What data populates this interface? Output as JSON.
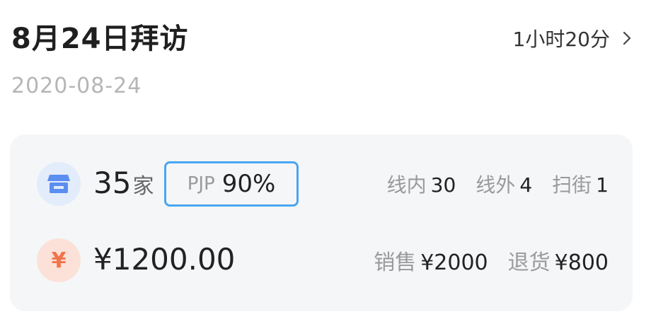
{
  "header": {
    "title": "8月24日拜访",
    "duration": "1小时20分",
    "date": "2020-08-24"
  },
  "summary": {
    "store_count": "35",
    "store_unit": "家",
    "pjp_label": "PJP",
    "pjp_value": "90%",
    "in_line_label": "线内",
    "in_line_value": "30",
    "out_line_label": "线外",
    "out_line_value": "4",
    "sweep_label": "扫街",
    "sweep_value": "1",
    "amount": "¥1200.00",
    "sales_label": "销售",
    "sales_value": "¥2000",
    "return_label": "退货",
    "return_value": "¥800"
  },
  "icons": {
    "store": "store-icon",
    "yen": "yen-icon",
    "chevron": "chevron-right-icon",
    "yen_glyph": "¥"
  },
  "colors": {
    "accent_border": "#4aa6f0",
    "store_icon_bg": "#e3ecfb",
    "store_icon": "#5a8ef0",
    "yen_icon_bg": "#fbe1d7",
    "yen_icon": "#f0744a"
  }
}
